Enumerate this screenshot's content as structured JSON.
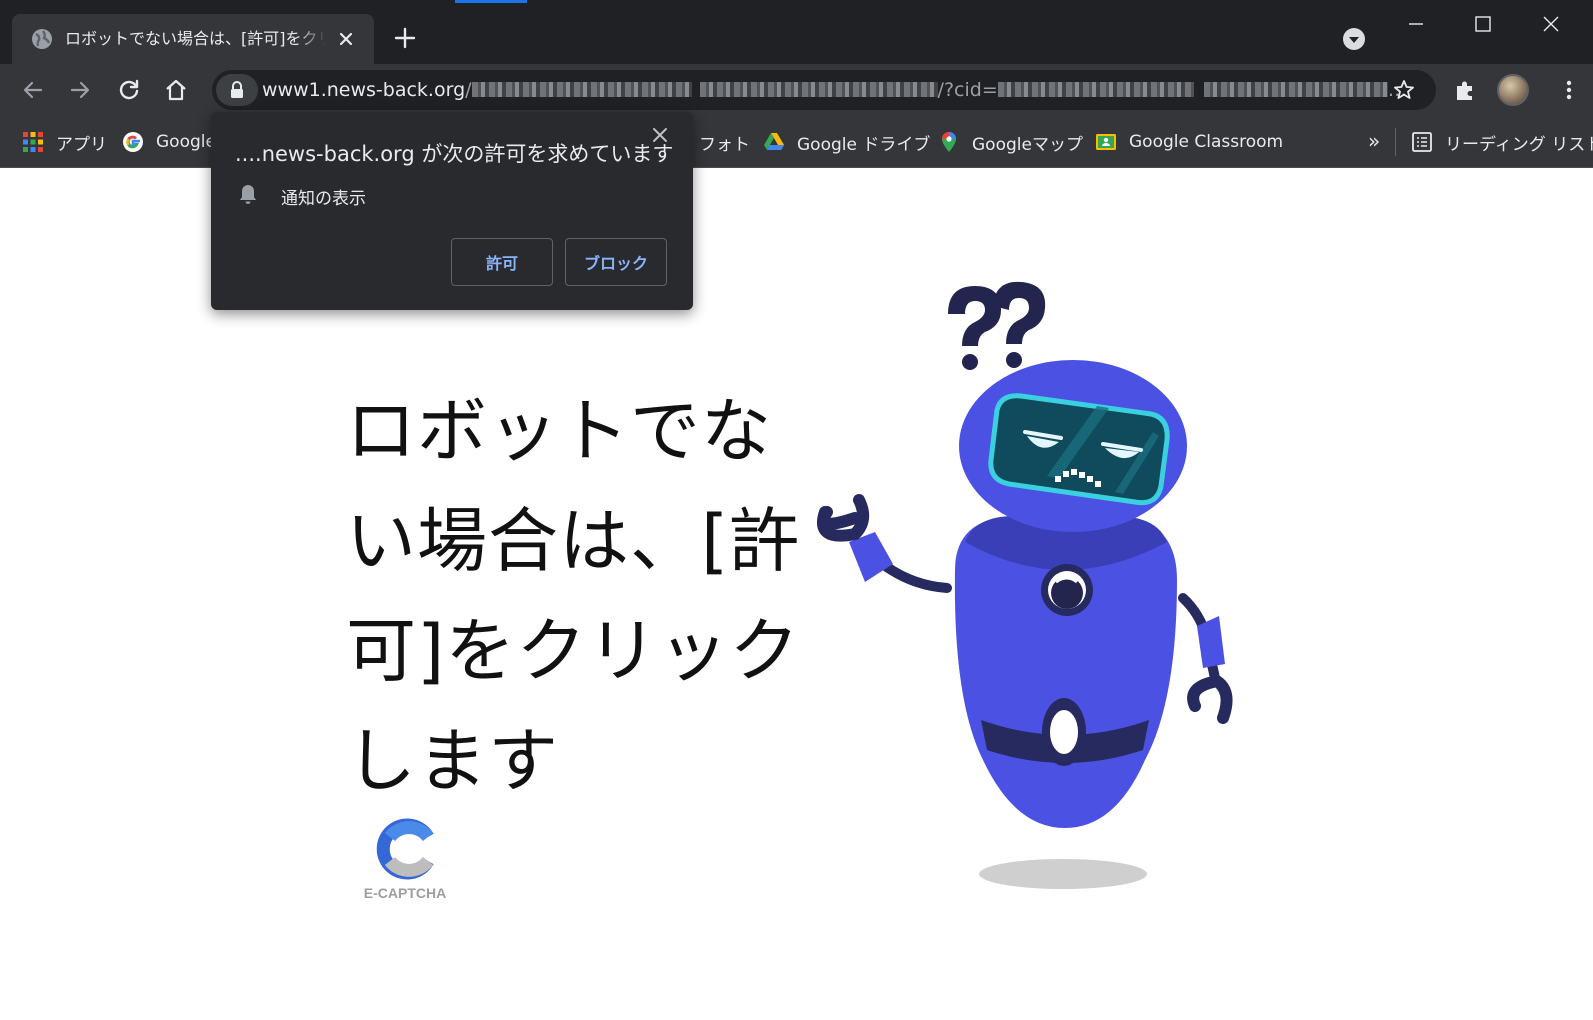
{
  "tab": {
    "title": "ロボットでない場合は、[許可]をクリック",
    "favicon": "globe-icon"
  },
  "toolbar": {
    "url_host": "www1.news-back.org",
    "url_path": "/",
    "url_query": "/?cid=",
    "url_ellipsis": "…"
  },
  "bookmarks": {
    "apps": "アプリ",
    "google": "Google",
    "photos": "フォト",
    "drive": "Google ドライブ",
    "maps": "Googleマップ",
    "classroom": "Google Classroom",
    "overflow": "»",
    "reading_list": "リーディング リスト"
  },
  "permission_popup": {
    "title": "....news-back.org が次の許可を求めています",
    "item": "通知の表示",
    "allow": "許可",
    "block": "ブロック"
  },
  "page": {
    "headline": "ロボットでない場合は、[許可]をクリックします",
    "captcha_label": "E-CAPTCHA"
  },
  "colors": {
    "robot_body": "#4b52e3",
    "robot_dark": "#272a5e",
    "visor": "#0f4b5c",
    "visor_rim": "#3ad0e0",
    "link_blue": "#8ab4f8"
  }
}
